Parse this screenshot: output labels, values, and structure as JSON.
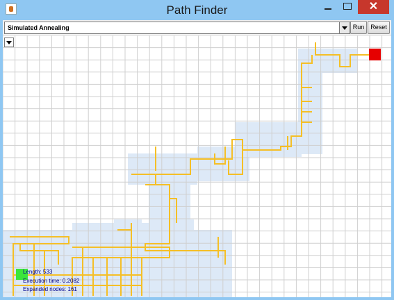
{
  "window": {
    "title": "Path Finder",
    "close_label": "✕"
  },
  "toolbar": {
    "algorithm": "Simulated Annealing",
    "run_label": "Run",
    "reset_label": "Reset"
  },
  "stats": {
    "length": "Length: 533",
    "execution_time": "Execution time: 0.2082",
    "expanded_nodes": "Expanded nodes: 161"
  },
  "colors": {
    "path": "#f5bf26",
    "explored": "#dde9f7",
    "start": "#3be63b",
    "goal": "#e60000",
    "grid": "#cfcfcf"
  }
}
